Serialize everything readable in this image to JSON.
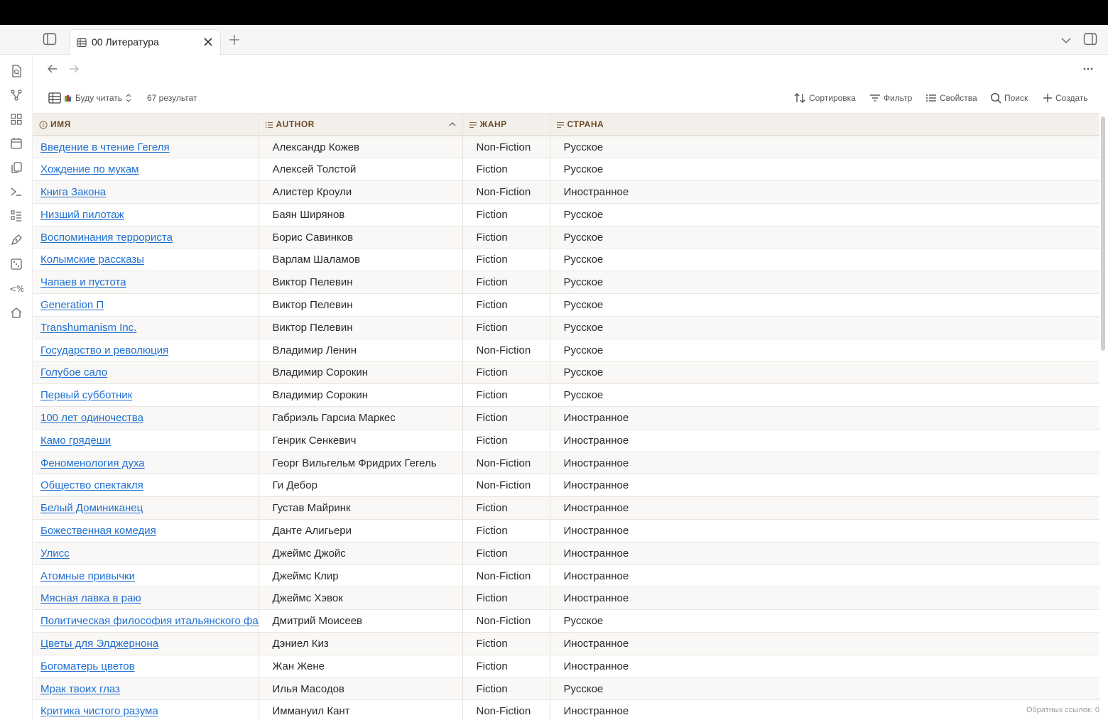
{
  "tab": {
    "title": "00 Литература"
  },
  "toolbar": {
    "view_name": "Буду читать",
    "result_count": "67 результат",
    "sort_label": "Сортировка",
    "filter_label": "Фильтр",
    "properties_label": "Свойства",
    "search_label": "Поиск",
    "create_label": "Создать"
  },
  "table": {
    "columns": [
      "ИМЯ",
      "AUTHOR",
      "ЖАНР",
      "СТРАНА"
    ],
    "rows": [
      {
        "name": "Введение в чтение Гегеля",
        "author": "Александр Кожев",
        "genre": "Non-Fiction",
        "country": "Русское"
      },
      {
        "name": "Хождение по мукам",
        "author": "Алексей Толстой",
        "genre": "Fiction",
        "country": "Русское"
      },
      {
        "name": "Книга Закона",
        "author": "Алистер Кроули",
        "genre": "Non-Fiction",
        "country": "Иностранное"
      },
      {
        "name": "Низший пилотаж",
        "author": "Баян Ширянов",
        "genre": "Fiction",
        "country": "Русское"
      },
      {
        "name": "Воспоминания террориста",
        "author": "Борис Савинков",
        "genre": "Fiction",
        "country": "Русское"
      },
      {
        "name": "Колымские рассказы",
        "author": "Варлам Шаламов",
        "genre": "Fiction",
        "country": "Русское"
      },
      {
        "name": "Чапаев и пустота",
        "author": "Виктор Пелевин",
        "genre": "Fiction",
        "country": "Русское"
      },
      {
        "name": "Generation П",
        "author": "Виктор Пелевин",
        "genre": "Fiction",
        "country": "Русское"
      },
      {
        "name": "Transhumanism Inc.",
        "author": "Виктор Пелевин",
        "genre": "Fiction",
        "country": "Русское"
      },
      {
        "name": "Государство и революция",
        "author": "Владимир Ленин",
        "genre": "Non-Fiction",
        "country": "Русское"
      },
      {
        "name": "Голубое сало",
        "author": "Владимир Сорокин",
        "genre": "Fiction",
        "country": "Русское"
      },
      {
        "name": "Первый субботник",
        "author": "Владимир Сорокин",
        "genre": "Fiction",
        "country": "Русское"
      },
      {
        "name": "100 лет одиночества",
        "author": "Габриэль Гарсиа Маркес",
        "genre": "Fiction",
        "country": "Иностранное"
      },
      {
        "name": "Камо грядеши",
        "author": "Генрик Сенкевич",
        "genre": "Fiction",
        "country": "Иностранное"
      },
      {
        "name": "Феноменология духа",
        "author": "Георг Вильгельм Фридрих Гегель",
        "genre": "Non-Fiction",
        "country": "Иностранное"
      },
      {
        "name": "Общество спектакля",
        "author": "Ги Дебор",
        "genre": "Non-Fiction",
        "country": "Иностранное"
      },
      {
        "name": "Белый Доминиканец",
        "author": "Густав Майринк",
        "genre": "Fiction",
        "country": "Иностранное"
      },
      {
        "name": "Божественная комедия",
        "author": "Данте Алигьери",
        "genre": "Fiction",
        "country": "Иностранное"
      },
      {
        "name": "Улисс",
        "author": "Джеймс Джойс",
        "genre": "Fiction",
        "country": "Иностранное"
      },
      {
        "name": "Атомные привычки",
        "author": "Джеймс Клир",
        "genre": "Non-Fiction",
        "country": "Иностранное"
      },
      {
        "name": "Мясная лавка в раю",
        "author": "Джеймс Хэвок",
        "genre": "Fiction",
        "country": "Иностранное"
      },
      {
        "name": "Политическая философия итальянского фашизма",
        "author": "Дмитрий Моисеев",
        "genre": "Non-Fiction",
        "country": "Русское"
      },
      {
        "name": "Цветы для Элджернона",
        "author": "Дэниел Киз",
        "genre": "Fiction",
        "country": "Иностранное"
      },
      {
        "name": "Богоматерь цветов",
        "author": "Жан Жене",
        "genre": "Fiction",
        "country": "Иностранное"
      },
      {
        "name": "Мрак твоих глаз",
        "author": "Илья Масодов",
        "genre": "Fiction",
        "country": "Русское"
      },
      {
        "name": "Критика чистого разума",
        "author": "Иммануил Кант",
        "genre": "Non-Fiction",
        "country": "Иностранное"
      }
    ]
  },
  "status": {
    "backlinks": "Обратных ссылок: 0"
  },
  "colors": {
    "link": "#1f6fd1",
    "header_text": "#6b4a26",
    "header_bg": "#f3f0eb"
  }
}
